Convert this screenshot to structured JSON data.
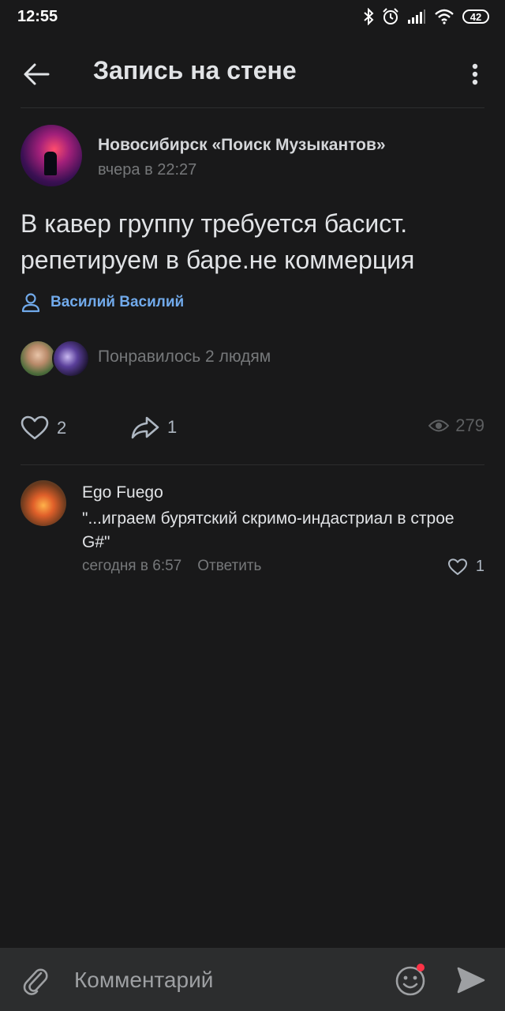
{
  "status_bar": {
    "time": "12:55",
    "battery": "42",
    "icons": [
      "bluetooth-icon",
      "alarm-icon",
      "signal-icon",
      "wifi-icon",
      "battery-icon"
    ]
  },
  "header": {
    "title": "Запись на стене",
    "back_icon": "arrow-left-icon",
    "menu_icon": "more-vertical-icon"
  },
  "post": {
    "group_name": "Новосибирск «Поиск Музыкантов»",
    "time": "вчера в 22:27",
    "text_line1": "В кавер группу требуется басист.",
    "text_line2": "репетируем в баре.не коммерция",
    "signer": "Василий Василий",
    "likers_text": "Понравилось 2 людям",
    "likes": "2",
    "shares": "1",
    "views": "279"
  },
  "comments": [
    {
      "author": "Ego Fuego",
      "text": "\"...играем бурятский скримо-индастриал в строе G#\"",
      "time": "сегодня в 6:57",
      "reply_label": "Ответить",
      "likes": "1"
    }
  ],
  "composer": {
    "placeholder": "Комментарий"
  },
  "colors": {
    "background": "#19191a",
    "composer_bg": "#2c2d2e",
    "link": "#71aaeb",
    "secondary_text": "#76787a",
    "notification_dot": "#ff3347"
  }
}
